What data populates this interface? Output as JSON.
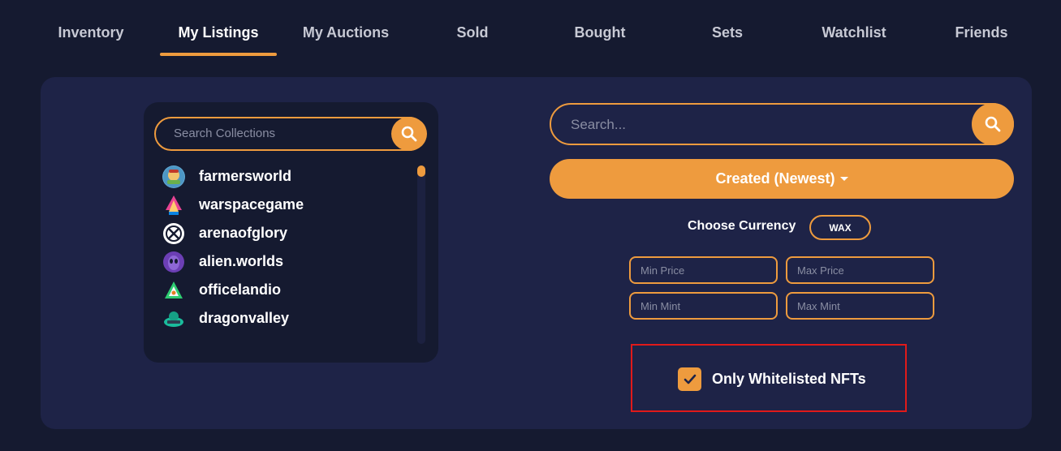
{
  "tabs": [
    {
      "label": "Inventory",
      "active": false
    },
    {
      "label": "My Listings",
      "active": true
    },
    {
      "label": "My Auctions",
      "active": false
    },
    {
      "label": "Sold",
      "active": false
    },
    {
      "label": "Bought",
      "active": false
    },
    {
      "label": "Sets",
      "active": false
    },
    {
      "label": "Watchlist",
      "active": false
    },
    {
      "label": "Friends",
      "active": false
    }
  ],
  "collections": {
    "search_placeholder": "Search Collections",
    "items": [
      {
        "label": "farmersworld",
        "icon": "farmersworld-logo-icon"
      },
      {
        "label": "warspacegame",
        "icon": "warspacegame-logo-icon"
      },
      {
        "label": "arenaofglory",
        "icon": "arenaofglory-logo-icon"
      },
      {
        "label": "alien.worlds",
        "icon": "alienworlds-logo-icon"
      },
      {
        "label": "officelandio",
        "icon": "officelandio-logo-icon"
      },
      {
        "label": "dragonvalley",
        "icon": "dragonvalley-logo-icon"
      }
    ]
  },
  "search": {
    "placeholder": "Search..."
  },
  "sort": {
    "label": "Created (Newest)"
  },
  "currency": {
    "label": "Choose Currency",
    "value": "WAX"
  },
  "filters": {
    "min_price": "Min Price",
    "max_price": "Max Price",
    "min_mint": "Min Mint",
    "max_mint": "Max Mint"
  },
  "whitelist": {
    "label": "Only Whitelisted NFTs",
    "checked": true
  },
  "colors": {
    "background": "#151a30",
    "panel": "#1e2347",
    "accent": "#ee9b3e",
    "highlight": "#e01a1a"
  }
}
